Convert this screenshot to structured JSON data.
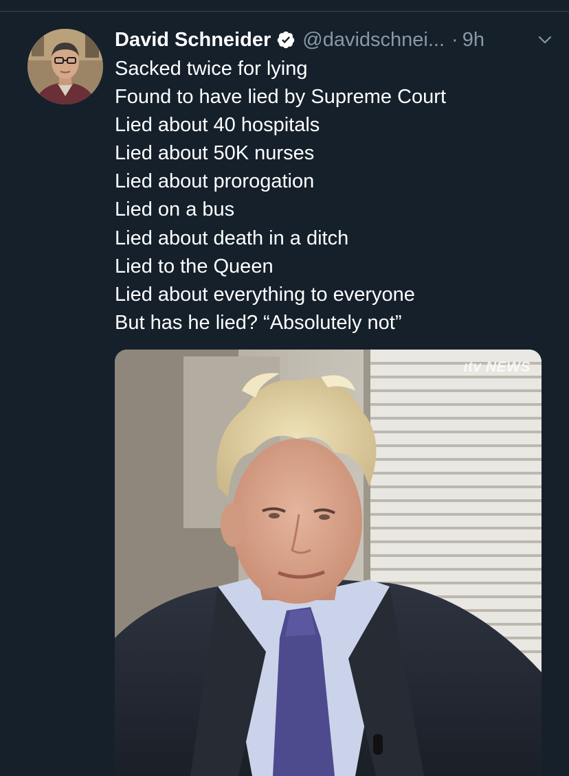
{
  "tweet": {
    "author": {
      "display_name": "David Schneider",
      "handle": "@davidschnei...",
      "verified": true
    },
    "separator": "·",
    "timestamp": "9h",
    "lines": [
      "Sacked twice for lying",
      "Found to have lied by Supreme Court",
      "Lied about 40 hospitals",
      "Lied about 50K nurses",
      "Lied about prorogation",
      "Lied on a bus",
      "Lied about death in a ditch",
      "Lied to the Queen",
      "Lied about everything to everyone",
      "But has he lied? “Absolutely not”"
    ],
    "media": {
      "watermark": "ıtv NEWS"
    }
  },
  "colors": {
    "background": "#15202b",
    "text_primary": "#ffffff",
    "text_secondary": "#8899a6",
    "divider": "#38444d"
  },
  "icons": [
    "verified-badge-icon",
    "chevron-down-icon"
  ]
}
